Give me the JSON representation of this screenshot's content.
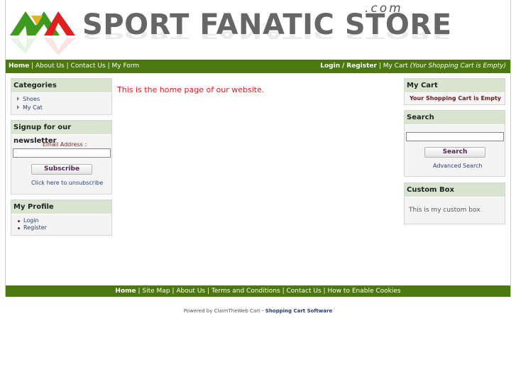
{
  "brand": {
    "name": "SPORT FANATIC STORE",
    "domain": ".com",
    "logo_colors": {
      "red": "#e02020",
      "gold": "#e3b21e",
      "green": "#3d9a1e"
    }
  },
  "top_nav": {
    "home": "Home",
    "sep": "|",
    "about": "About Us",
    "contact": "Contact Us",
    "form": "My Form",
    "login": "Login",
    "slash": "/",
    "register": "Register",
    "my_cart": "My Cart",
    "cart_status": "(Your Shopping Cart is Empty)"
  },
  "left": {
    "categories": {
      "title": "Categories",
      "items": [
        "Shoes",
        "My Cat"
      ]
    },
    "newsletter": {
      "title": "Signup for our newsletter",
      "email_label": "Email Address :",
      "email_value": "",
      "subscribe": "Subscribe",
      "unsubscribe": "Click here to unsubscribe"
    },
    "profile": {
      "title": "My Profile",
      "items": [
        "Login",
        "Register"
      ]
    }
  },
  "main": {
    "text": "This is the home page of our website."
  },
  "right": {
    "cart": {
      "title": "My Cart",
      "status": "Your Shopping Cart is Empty"
    },
    "search": {
      "title": "Search",
      "value": "",
      "button": "Search",
      "advanced": "Advanced Search"
    },
    "custom": {
      "title": "Custom Box",
      "text": "This is my custom box"
    }
  },
  "footer": {
    "home": "Home",
    "sep": "|",
    "sitemap": "Site Map",
    "about": "About Us",
    "terms": "Terms and Conditions",
    "contact": "Contact Us",
    "cookies": "How to Enable Cookies"
  },
  "powered": {
    "prefix": "Powered by ClaimTheWeb Cart -",
    "link": "Shopping Cart Software"
  },
  "colors": {
    "nav_green": "#4b780f",
    "box_header": "#d8e4d0",
    "main_text": "#e01a1a"
  }
}
